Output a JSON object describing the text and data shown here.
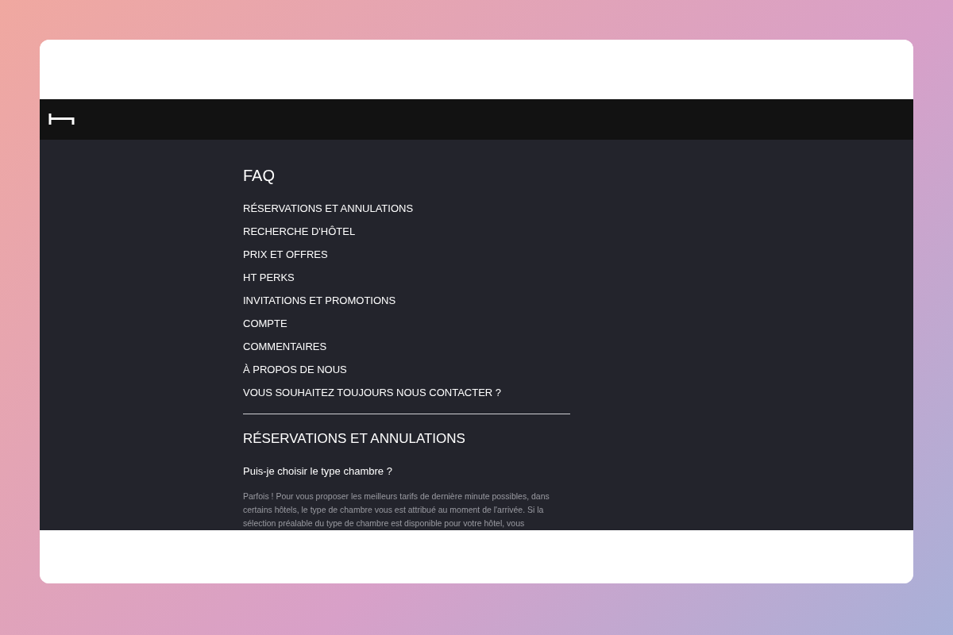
{
  "page_title": "FAQ",
  "topics": [
    "RÉSERVATIONS ET ANNULATIONS",
    "RECHERCHE D'HÔTEL",
    "PRIX ET OFFRES",
    "HT PERKS",
    "INVITATIONS ET PROMOTIONS",
    "COMPTE",
    "COMMENTAIRES",
    "À PROPOS DE NOUS",
    "VOUS SOUHAITEZ TOUJOURS NOUS CONTACTER ?"
  ],
  "section": {
    "heading": "RÉSERVATIONS ET ANNULATIONS",
    "question": "Puis-je choisir le type chambre ?",
    "answer": "Parfois ! Pour vous proposer les meilleurs tarifs de dernière minute possibles, dans certains hôtels, le type de chambre vous est attribué au moment de l'arrivée. Si la sélection préalable du type de chambre est disponible pour votre hôtel, vous"
  }
}
